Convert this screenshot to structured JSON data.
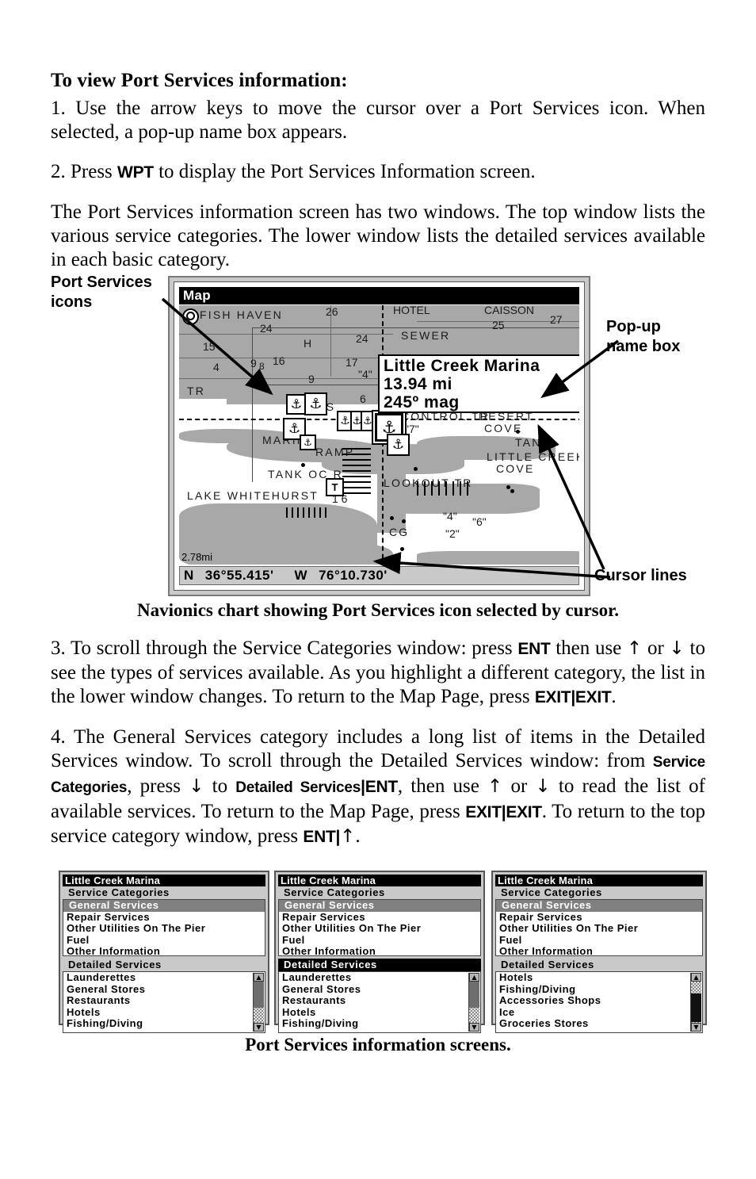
{
  "document": {
    "heading": "To view Port Services information:",
    "step1_a": "1. Use the arrow keys to move the cursor over a Port Services icon. When selected, a pop-up name box appears.",
    "step2_a": "2. Press ",
    "step2_kbd": "WPT",
    "step2_b": " to display the Port Services Information screen.",
    "intro": "The Port Services information screen has two windows. The top window lists the various service categories. The lower window lists the detailed services available in each basic category.",
    "step3_a": "3. To scroll through the Service Categories window: press ",
    "step3_kbd1": "ENT",
    "step3_b": " then use ",
    "step3_up": "↑",
    "step3_c": " or ",
    "step3_down": "↓",
    "step3_d": " to see the types of services available. As you highlight a different category, the list in the lower window changes. To return to the Map Page, press ",
    "step3_kbd2": "EXIT",
    "step3_sep": "|",
    "step3_kbd3": "EXIT",
    "step3_e": ".",
    "step4_a": "4. The General Services category includes a long list of items in the Detailed Services window. To scroll through the Detailed Services window: from ",
    "step4_sc": "Service Categories",
    "step4_b": ", press ",
    "step4_down1": "↓",
    "step4_c": " to ",
    "step4_ds": "Detailed Services",
    "step4_sep1": "|",
    "step4_ent1": "ENT",
    "step4_d": ", then use ",
    "step4_up1": "↑",
    "step4_e": " or ",
    "step4_down2": "↓",
    "step4_f": " to read the list of available services. To return to the Map Page, press ",
    "step4_exit1": "EXIT",
    "step4_sep2": "|",
    "step4_exit2": "EXIT",
    "step4_g": ". To return to the top service category window, press ",
    "step4_ent2": "ENT",
    "step4_sep3": "|",
    "step4_up2": "↑",
    "step4_h": "."
  },
  "callouts": {
    "port_services_icons": "Port Services\nicons",
    "popup_name_box": "Pop-up\nname box",
    "cursor_lines": "Cursor lines"
  },
  "figure_captions": {
    "map": "Navionics chart showing Port Services icon selected by cursor.",
    "screens": "Port Services information screens."
  },
  "map_screen": {
    "title": "Map",
    "scale_label": "2.78mi",
    "status": {
      "lat_hemisphere": "N",
      "latitude": "36°55.415'",
      "lon_hemisphere": "W",
      "longitude": "76°10.730'"
    },
    "popup": {
      "name": "Little Creek Marina",
      "distance": "13.94 mi",
      "bearing": "245º mag"
    },
    "labels": [
      "FISH HAVEN",
      "SEWER",
      "HOTEL",
      "CAISSON",
      "TR",
      "MANS",
      "MARINA",
      "RAMP",
      "TANK OC R",
      "LAKE WHITEHURST",
      "CONTROL TR",
      "DESERT COVE",
      "LITTLE CREEK COVE",
      "TANK",
      "LOOKOUT TR",
      "CG"
    ],
    "depth_numbers": [
      "26",
      "27",
      "25",
      "24",
      "15",
      "16",
      "9",
      "8",
      "4",
      "17",
      "7",
      "6",
      "1 6",
      "\"4\"",
      "\"2\"",
      "\"6\"",
      "\"7\""
    ],
    "icons": {
      "port_service": "anchor-icon",
      "tower": "T",
      "north_indicator": "compass-icon"
    }
  },
  "info_screens": [
    {
      "title": "Little Creek Marina",
      "categories_header": "Service Categories",
      "categories_header_highlighted": false,
      "categories": [
        "General Services",
        "Repair Services",
        "Other Utilities On The Pier",
        "Fuel",
        "Other Information"
      ],
      "selected_category": "General Services",
      "detailed_header": "Detailed Services",
      "detailed_header_highlighted": false,
      "detailed": [
        "Launderettes",
        "General Stores",
        "Restaurants",
        "Hotels",
        "Fishing/Diving"
      ],
      "scroll_position": "top",
      "scroll_up_arrow": "▲",
      "scroll_down_arrow": "▼"
    },
    {
      "title": "Little Creek Marina",
      "categories_header": "Service Categories",
      "categories_header_highlighted": false,
      "categories": [
        "General Services",
        "Repair Services",
        "Other Utilities On The Pier",
        "Fuel",
        "Other Information"
      ],
      "selected_category": "General Services",
      "detailed_header": "Detailed Services",
      "detailed_header_highlighted": true,
      "detailed": [
        "Launderettes",
        "General Stores",
        "Restaurants",
        "Hotels",
        "Fishing/Diving"
      ],
      "scroll_position": "top",
      "scroll_up_arrow": "▲",
      "scroll_down_arrow": "▼"
    },
    {
      "title": "Little Creek Marina",
      "categories_header": "Service Categories",
      "categories_header_highlighted": false,
      "categories": [
        "General Services",
        "Repair Services",
        "Other Utilities On The Pier",
        "Fuel",
        "Other Information"
      ],
      "selected_category": "General Services",
      "detailed_header": "Detailed Services",
      "detailed_header_highlighted": false,
      "detailed": [
        "Hotels",
        "Fishing/Diving",
        "Accessories Shops",
        "Ice",
        "Groceries Stores"
      ],
      "scroll_position": "middle",
      "scroll_up_arrow": "▲",
      "scroll_down_arrow": "▼"
    }
  ],
  "colors": {
    "land": "#a8a8a8",
    "screen_bezel": "#c9c9c9",
    "highlight": "#808080",
    "titlebar": "#000000"
  }
}
